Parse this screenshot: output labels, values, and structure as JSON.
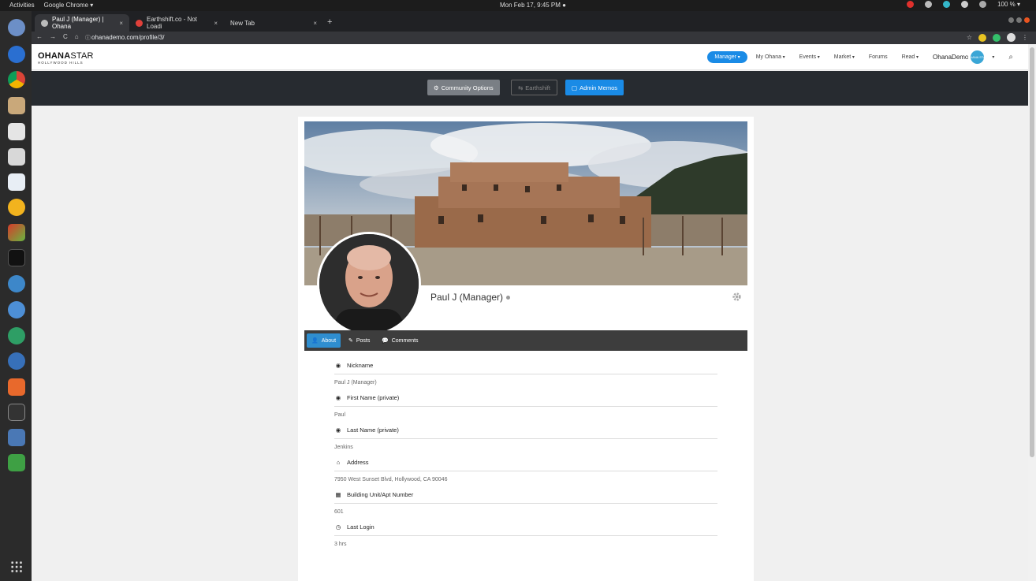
{
  "system": {
    "activities": "Activities",
    "app_menu": "Google Chrome ▾",
    "clock": "Mon Feb 17,  9:45 PM ●",
    "battery": "100 % ▾"
  },
  "browser": {
    "tabs": [
      {
        "label": "Paul J (Manager) | Ohana",
        "close": "×"
      },
      {
        "label": "Earthshift.co - Not Loadi",
        "close": "×"
      },
      {
        "label": "New Tab",
        "close": "×"
      }
    ],
    "new_tab": "+",
    "url": "ohanademo.com/profile/3/"
  },
  "site": {
    "logo_main_bold": "OHANA",
    "logo_main_rest": "STAR",
    "logo_sub": "HOLLYWOOD HILLS",
    "nav": {
      "manager": "Manager",
      "my_ohana": "My Ohana",
      "events": "Events",
      "market": "Market",
      "forums": "Forums",
      "read": "Read",
      "user": "OhanaDemo",
      "avatar_text": "OHANA STAR"
    },
    "admin": {
      "community_options": "Community Options",
      "earthshift": "Earthshift",
      "admin_memos": "Admin Memos"
    },
    "profile": {
      "name": "Paul J (Manager)",
      "tabs": {
        "about": "About",
        "posts": "Posts",
        "comments": "Comments"
      },
      "fields": [
        {
          "label": "Nickname",
          "value": "Paul J (Manager)",
          "icon": "user-secret-icon"
        },
        {
          "label": "First Name (private)",
          "value": "Paul",
          "icon": "user-circle-icon"
        },
        {
          "label": "Last Name (private)",
          "value": "Jenkins",
          "icon": "user-circle-icon"
        },
        {
          "label": "Address",
          "value": "7950 West Sunset Blvd, Hollywood, CA 90046",
          "icon": "home-icon"
        },
        {
          "label": "Building Unit/Apt Number",
          "value": "601",
          "icon": "building-icon"
        },
        {
          "label": "Last Login",
          "value": "3 hrs",
          "icon": "clock-icon"
        }
      ]
    }
  },
  "colors": {
    "primary": "#1a8be6",
    "admin_bar": "#272b30",
    "tab_active": "#2f8ecf"
  }
}
